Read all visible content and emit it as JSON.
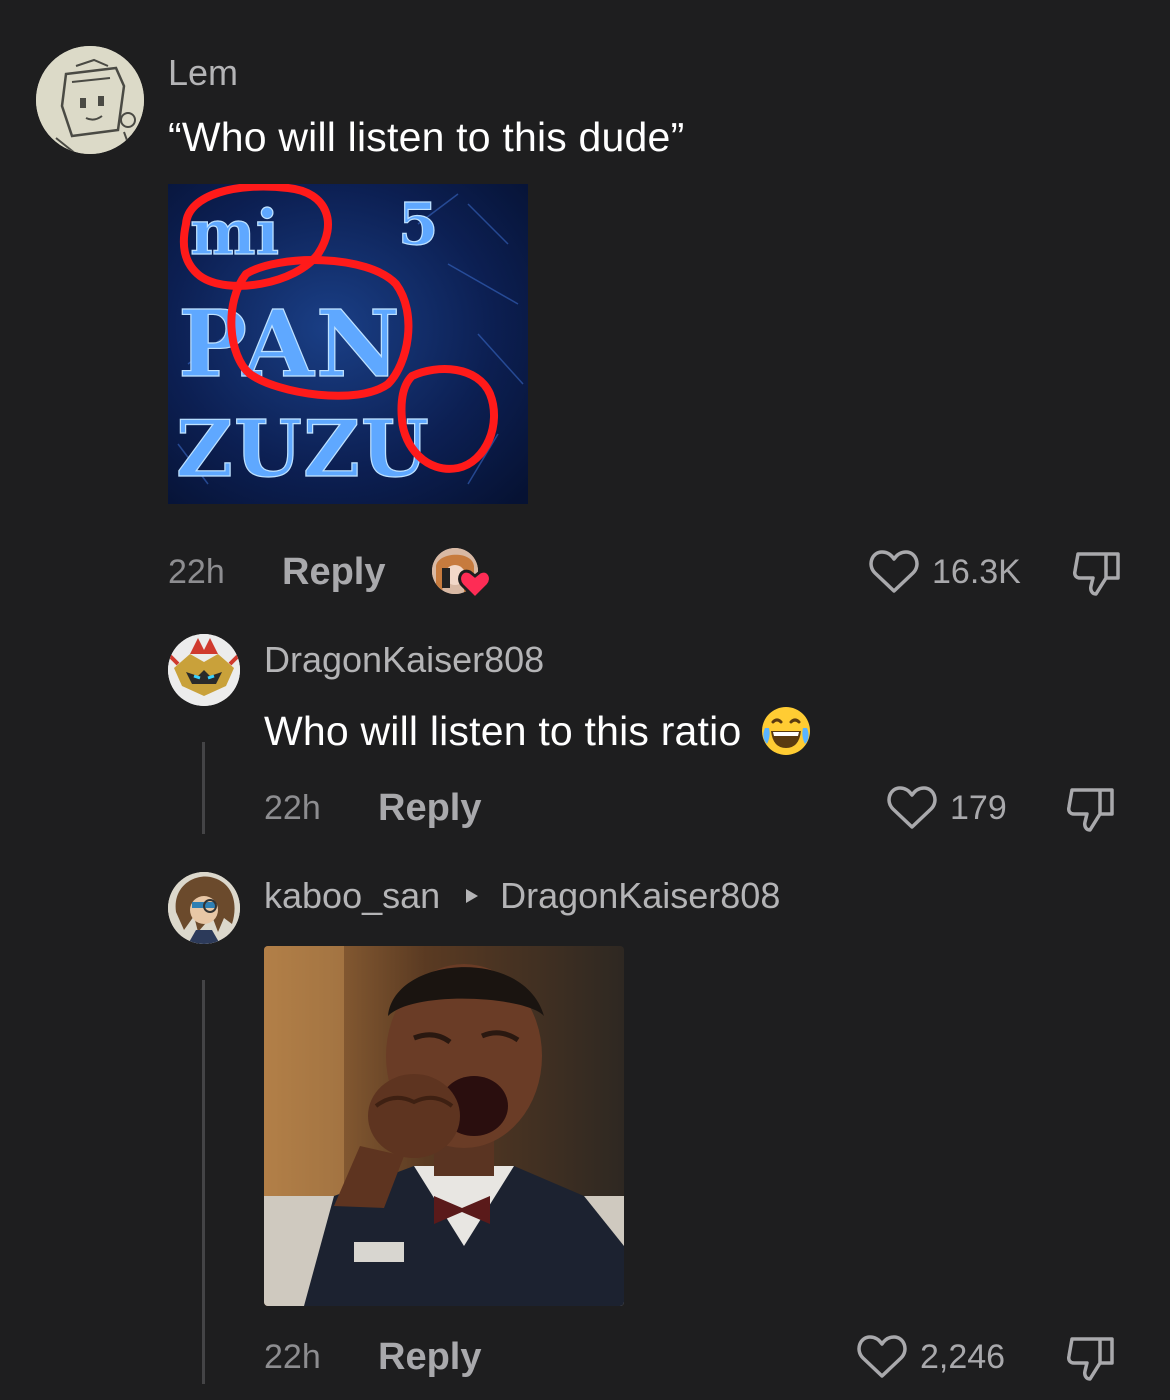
{
  "comments": [
    {
      "username": "Lem",
      "text": "“Who will listen to this dude”",
      "time": "22h",
      "reply_label": "Reply",
      "likes": "16.3K",
      "image_text": [
        "mi",
        "5",
        "PAN",
        "ZUZU"
      ]
    },
    {
      "username": "DragonKaiser808",
      "text": "Who will listen to this ratio",
      "emoji": "😂",
      "time": "22h",
      "reply_label": "Reply",
      "likes": "179"
    },
    {
      "username": "kaboo_san",
      "reply_to": "DragonKaiser808",
      "time": "22h",
      "reply_label": "Reply",
      "likes": "2,246"
    }
  ],
  "icons": {
    "like": "heart-outline-icon",
    "dislike": "thumbs-down-icon",
    "creator_liked": "creator-liked-heart-icon",
    "reply_arrow": "triangle-right-icon"
  },
  "colors": {
    "background": "#1e1e1f",
    "liked_badge": "#fe2c55",
    "muted_text": "#a9a9ac"
  }
}
